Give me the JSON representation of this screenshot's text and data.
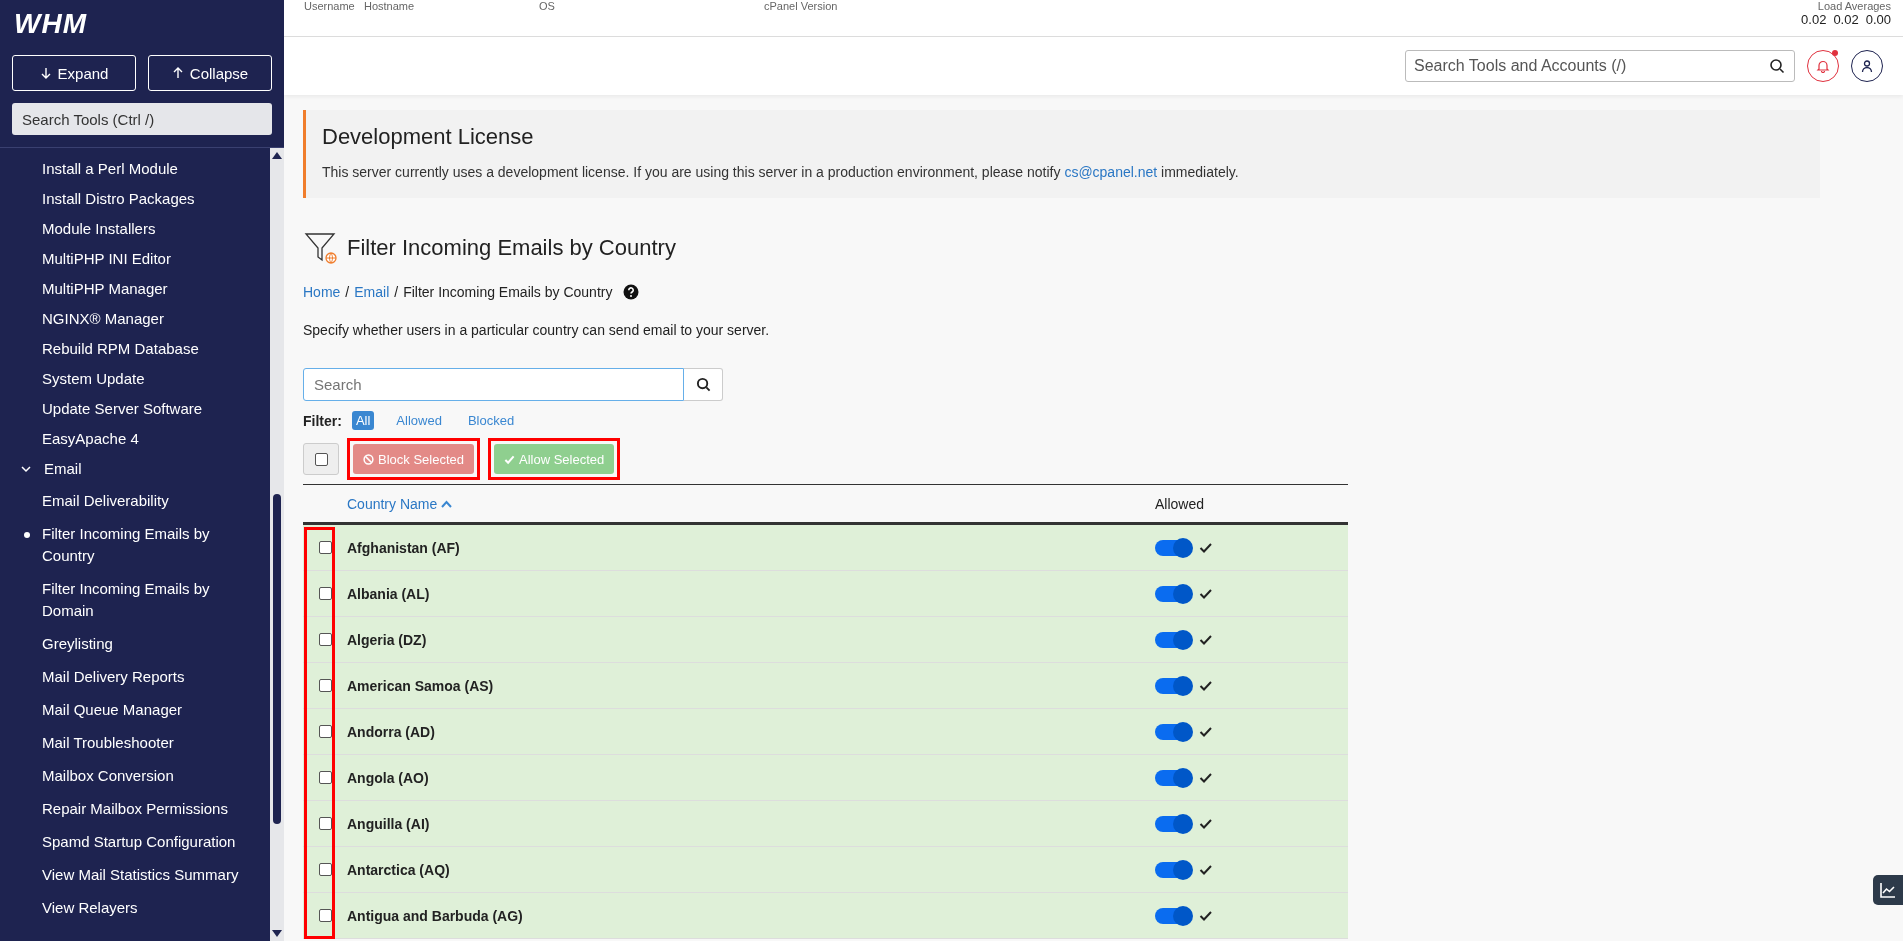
{
  "sidebar": {
    "logo": "WHM",
    "expand": "Expand",
    "collapse": "Collapse",
    "search_placeholder": "Search Tools (Ctrl /)",
    "items": [
      {
        "label": "Install a Perl Module"
      },
      {
        "label": "Install Distro Packages"
      },
      {
        "label": "Module Installers"
      },
      {
        "label": "MultiPHP INI Editor"
      },
      {
        "label": "MultiPHP Manager"
      },
      {
        "label": "NGINX® Manager"
      },
      {
        "label": "Rebuild RPM Database"
      },
      {
        "label": "System Update"
      },
      {
        "label": "Update Server Software"
      },
      {
        "label": "EasyApache 4"
      },
      {
        "label": "Email",
        "expanded": true,
        "children": [
          {
            "label": "Email Deliverability",
            "selected": false
          },
          {
            "label": "Filter Incoming Emails by Country",
            "selected": true
          },
          {
            "label": "Filter Incoming Emails by Domain",
            "selected": false
          },
          {
            "label": "Greylisting",
            "selected": false
          },
          {
            "label": "Mail Delivery Reports",
            "selected": false
          },
          {
            "label": "Mail Queue Manager",
            "selected": false
          },
          {
            "label": "Mail Troubleshooter",
            "selected": false
          },
          {
            "label": "Mailbox Conversion",
            "selected": false
          },
          {
            "label": "Repair Mailbox Permissions",
            "selected": false
          },
          {
            "label": "Spamd Startup Configuration",
            "selected": false
          },
          {
            "label": "View Mail Statistics Summary",
            "selected": false
          },
          {
            "label": "View Relayers",
            "selected": false
          }
        ]
      }
    ]
  },
  "server_info": {
    "fields": [
      "Username",
      "Hostname",
      "OS",
      "cPanel Version"
    ],
    "load_label": "Load Averages",
    "load_values": [
      "0.02",
      "0.02",
      "0.00"
    ]
  },
  "topbar": {
    "search_placeholder": "Search Tools and Accounts (/)",
    "unread_notifications": true
  },
  "license": {
    "title": "Development License",
    "text": "This server currently uses a development license. If you are using this server in a production environment, please notify ",
    "link": "cs@cpanel.net",
    "text_after": " immediately."
  },
  "page": {
    "title": "Filter Incoming Emails by Country",
    "breadcrumbs": [
      {
        "label": "Home",
        "link": true
      },
      {
        "label": "Email",
        "link": true
      },
      {
        "label": "Filter Incoming Emails by Country",
        "link": false
      }
    ],
    "breadcrumb_separator": "/",
    "description": "Specify whether users in a particular country can send email to your server.",
    "search_placeholder": "Search",
    "filter_label": "Filter:",
    "filters": [
      {
        "label": "All",
        "selected": true
      },
      {
        "label": "Allowed",
        "selected": false
      },
      {
        "label": "Blocked",
        "selected": false
      }
    ],
    "select_all_checked": false,
    "block_button": "Block Selected",
    "allow_button": "Allow Selected"
  },
  "table": {
    "columns": [
      "Country Name",
      "Allowed"
    ],
    "rows": [
      {
        "name": "Afghanistan (AF)",
        "checked": false,
        "allowed": true
      },
      {
        "name": "Albania (AL)",
        "checked": false,
        "allowed": true
      },
      {
        "name": "Algeria (DZ)",
        "checked": false,
        "allowed": true
      },
      {
        "name": "American Samoa (AS)",
        "checked": false,
        "allowed": true
      },
      {
        "name": "Andorra (AD)",
        "checked": false,
        "allowed": true
      },
      {
        "name": "Angola (AO)",
        "checked": false,
        "allowed": true
      },
      {
        "name": "Anguilla (AI)",
        "checked": false,
        "allowed": true
      },
      {
        "name": "Antarctica (AQ)",
        "checked": false,
        "allowed": true
      },
      {
        "name": "Antigua and Barbuda (AG)",
        "checked": false,
        "allowed": true
      }
    ]
  }
}
